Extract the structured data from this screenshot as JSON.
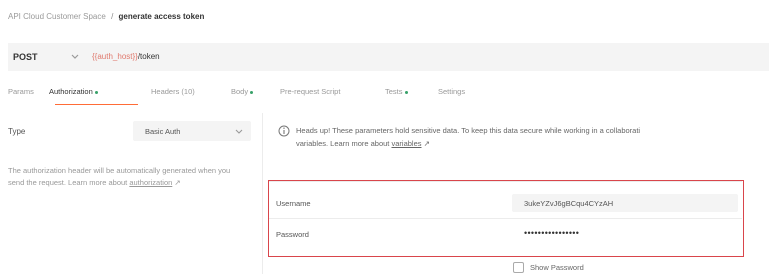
{
  "breadcrumb": {
    "workspace": "API Cloud Customer Space",
    "separator": "/",
    "current": "generate access token"
  },
  "request": {
    "method": "POST",
    "url_variable": "{{auth_host}}",
    "url_path": "/token"
  },
  "tabs": [
    {
      "label": "Params",
      "active": false,
      "dot": false
    },
    {
      "label": "Authorization",
      "active": true,
      "dot": true
    },
    {
      "label": "Headers (10)",
      "active": false,
      "dot": false
    },
    {
      "label": "Body",
      "active": false,
      "dot": true
    },
    {
      "label": "Pre-request Script",
      "active": false,
      "dot": false
    },
    {
      "label": "Tests",
      "active": false,
      "dot": true
    },
    {
      "label": "Settings",
      "active": false,
      "dot": false
    }
  ],
  "auth": {
    "type_label": "Type",
    "type_value": "Basic Auth",
    "description": "The authorization header will be automatically generated when you send the request. Learn more about",
    "description_link": "authorization",
    "description_arrow": "↗"
  },
  "notice": {
    "text": "Heads up! These parameters hold sensitive data. To keep this data secure while working in a collaborati",
    "text2": "variables. Learn more about",
    "link": "variables",
    "arrow": "↗"
  },
  "credentials": {
    "username_label": "Username",
    "username_value": "3ukeYZvJ6gBCqu4CYzAH",
    "password_label": "Password",
    "password_value": "••••••••••••••••"
  },
  "show_password_label": "Show Password",
  "colors": {
    "accent": "#ff6c37",
    "highlight_border": "#d9454b",
    "indicator_dot": "#38a169",
    "variable_text": "#e07a6e"
  }
}
